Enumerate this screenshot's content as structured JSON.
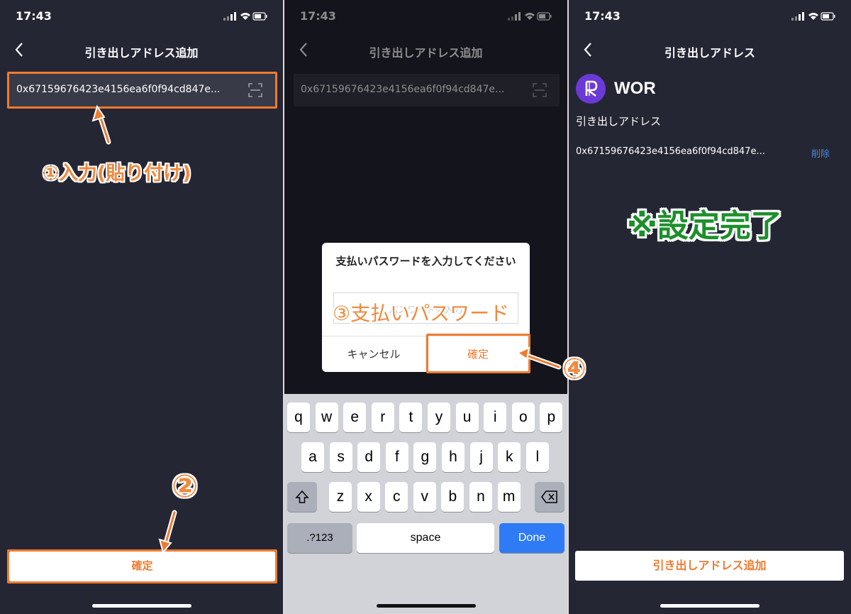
{
  "colors": {
    "panel_bg": "#252634",
    "accent": "#ef7b30",
    "link": "#4a88d8",
    "keyboard_done": "#2f7bf6",
    "complete": "#1d8f2b"
  },
  "status": {
    "time": "17:43"
  },
  "panel1": {
    "title": "引き出しアドレス追加",
    "address": "0x67159676423e4156ea6f0f94cd847e...",
    "annotation_input": "①入力(貼り付け)",
    "annotation_step2": "②",
    "confirm_label": "確定"
  },
  "panel2": {
    "title": "引き出しアドレス追加",
    "address": "0x67159676423e4156ea6f0f94cd847e...",
    "dialog_title": "支払いパスワードを入力してください",
    "dialog_placeholder": "パスワードを入力",
    "annotation_password": "③支払いパスワード",
    "cancel_label": "キャンセル",
    "confirm_label": "確定",
    "annotation_step4": "④",
    "keyboard": {
      "row1": [
        "q",
        "w",
        "e",
        "r",
        "t",
        "y",
        "u",
        "i",
        "o",
        "p"
      ],
      "row2": [
        "a",
        "s",
        "d",
        "f",
        "g",
        "h",
        "j",
        "k",
        "l"
      ],
      "row3": [
        "z",
        "x",
        "c",
        "v",
        "b",
        "n",
        "m"
      ],
      "numbers_label": ".?123",
      "space_label": "space",
      "done_label": "Done"
    }
  },
  "panel3": {
    "title": "引き出しアドレス",
    "coin_name": "WOR",
    "section_label": "引き出しアドレス",
    "address": "0x67159676423e4156ea6f0f94cd847e...",
    "delete_label": "削除",
    "complete_note": "※設定完了",
    "add_button_label": "引き出しアドレス追加"
  }
}
